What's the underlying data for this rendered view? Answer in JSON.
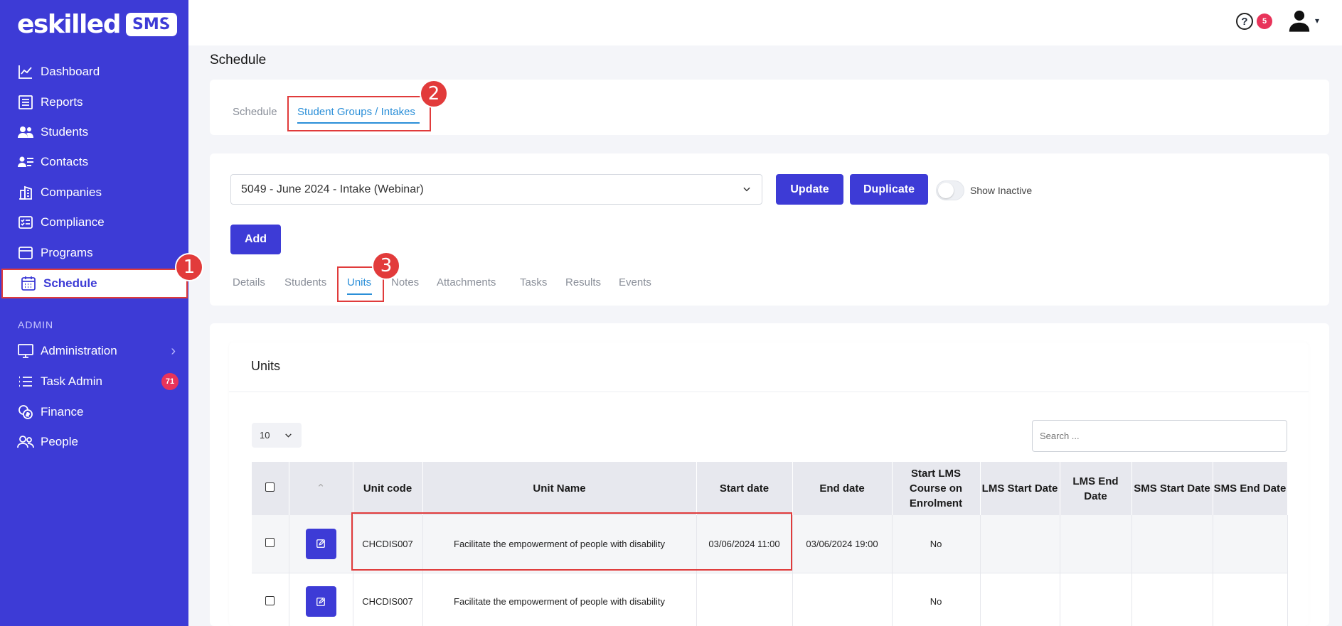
{
  "brand": {
    "logo_text": "eskilled",
    "logo_badge": "SMS",
    "collapse_glyph": "«"
  },
  "sidebar": {
    "items": [
      {
        "label": "Dashboard",
        "icon": "chart-line-icon"
      },
      {
        "label": "Reports",
        "icon": "report-icon"
      },
      {
        "label": "Students",
        "icon": "users-icon"
      },
      {
        "label": "Contacts",
        "icon": "contact-card-icon"
      },
      {
        "label": "Companies",
        "icon": "building-icon"
      },
      {
        "label": "Compliance",
        "icon": "checklist-icon"
      },
      {
        "label": "Programs",
        "icon": "window-icon"
      },
      {
        "label": "Schedule",
        "icon": "calendar-icon",
        "active": true
      }
    ],
    "section_label": "ADMIN",
    "admin_items": [
      {
        "label": "Administration",
        "icon": "monitor-icon"
      },
      {
        "label": "Task Admin",
        "icon": "list-icon",
        "badge": "71"
      },
      {
        "label": "Finance",
        "icon": "coins-icon"
      },
      {
        "label": "People",
        "icon": "people-icon"
      }
    ]
  },
  "topbar": {
    "help_glyph": "?",
    "help_badge": "5"
  },
  "page": {
    "title": "Schedule"
  },
  "top_tabs": [
    {
      "label": "Schedule",
      "active": false
    },
    {
      "label": "Student Groups / Intakes",
      "active": true
    }
  ],
  "group": {
    "selected_intake": "5049 - June 2024 - Intake (Webinar)",
    "update_label": "Update",
    "duplicate_label": "Duplicate",
    "show_inactive_label": "Show Inactive",
    "add_label": "Add"
  },
  "sub_tabs": [
    {
      "label": "Details",
      "active": false
    },
    {
      "label": "Students",
      "active": false
    },
    {
      "label": "Units",
      "active": true
    },
    {
      "label": "Notes",
      "active": false
    },
    {
      "label": "Attachments",
      "active": false
    },
    {
      "label": "Tasks",
      "active": false
    },
    {
      "label": "Results",
      "active": false
    },
    {
      "label": "Events",
      "active": false
    }
  ],
  "callouts": [
    "1",
    "2",
    "3"
  ],
  "units": {
    "title": "Units",
    "page_length": "10",
    "search_placeholder": "Search ...",
    "sort_glyph": "⌃",
    "columns": [
      "Unit code",
      "Unit Name",
      "Start date",
      "End date",
      "Start LMS Course on Enrolment",
      "LMS Start Date",
      "LMS End Date",
      "SMS Start Date",
      "SMS End Date"
    ],
    "rows": [
      {
        "code": "CHCDIS007",
        "name": "Facilitate the empowerment of people with disability",
        "start": "03/06/2024 11:00",
        "end": "03/06/2024 19:00",
        "lms_on_enrol": "No",
        "lms_start": "",
        "lms_end": "",
        "sms_start": "",
        "sms_end": ""
      },
      {
        "code": "CHCDIS007",
        "name": "Facilitate the empowerment of people with disability",
        "start": "",
        "end": "",
        "lms_on_enrol": "No",
        "lms_start": "",
        "lms_end": "",
        "sms_start": "",
        "sms_end": ""
      }
    ]
  },
  "colors": {
    "primary": "#3d3bd6",
    "accent_blue": "#2b8fd8",
    "callout_red": "#e23b3b",
    "badge_pink": "#e8345a"
  }
}
